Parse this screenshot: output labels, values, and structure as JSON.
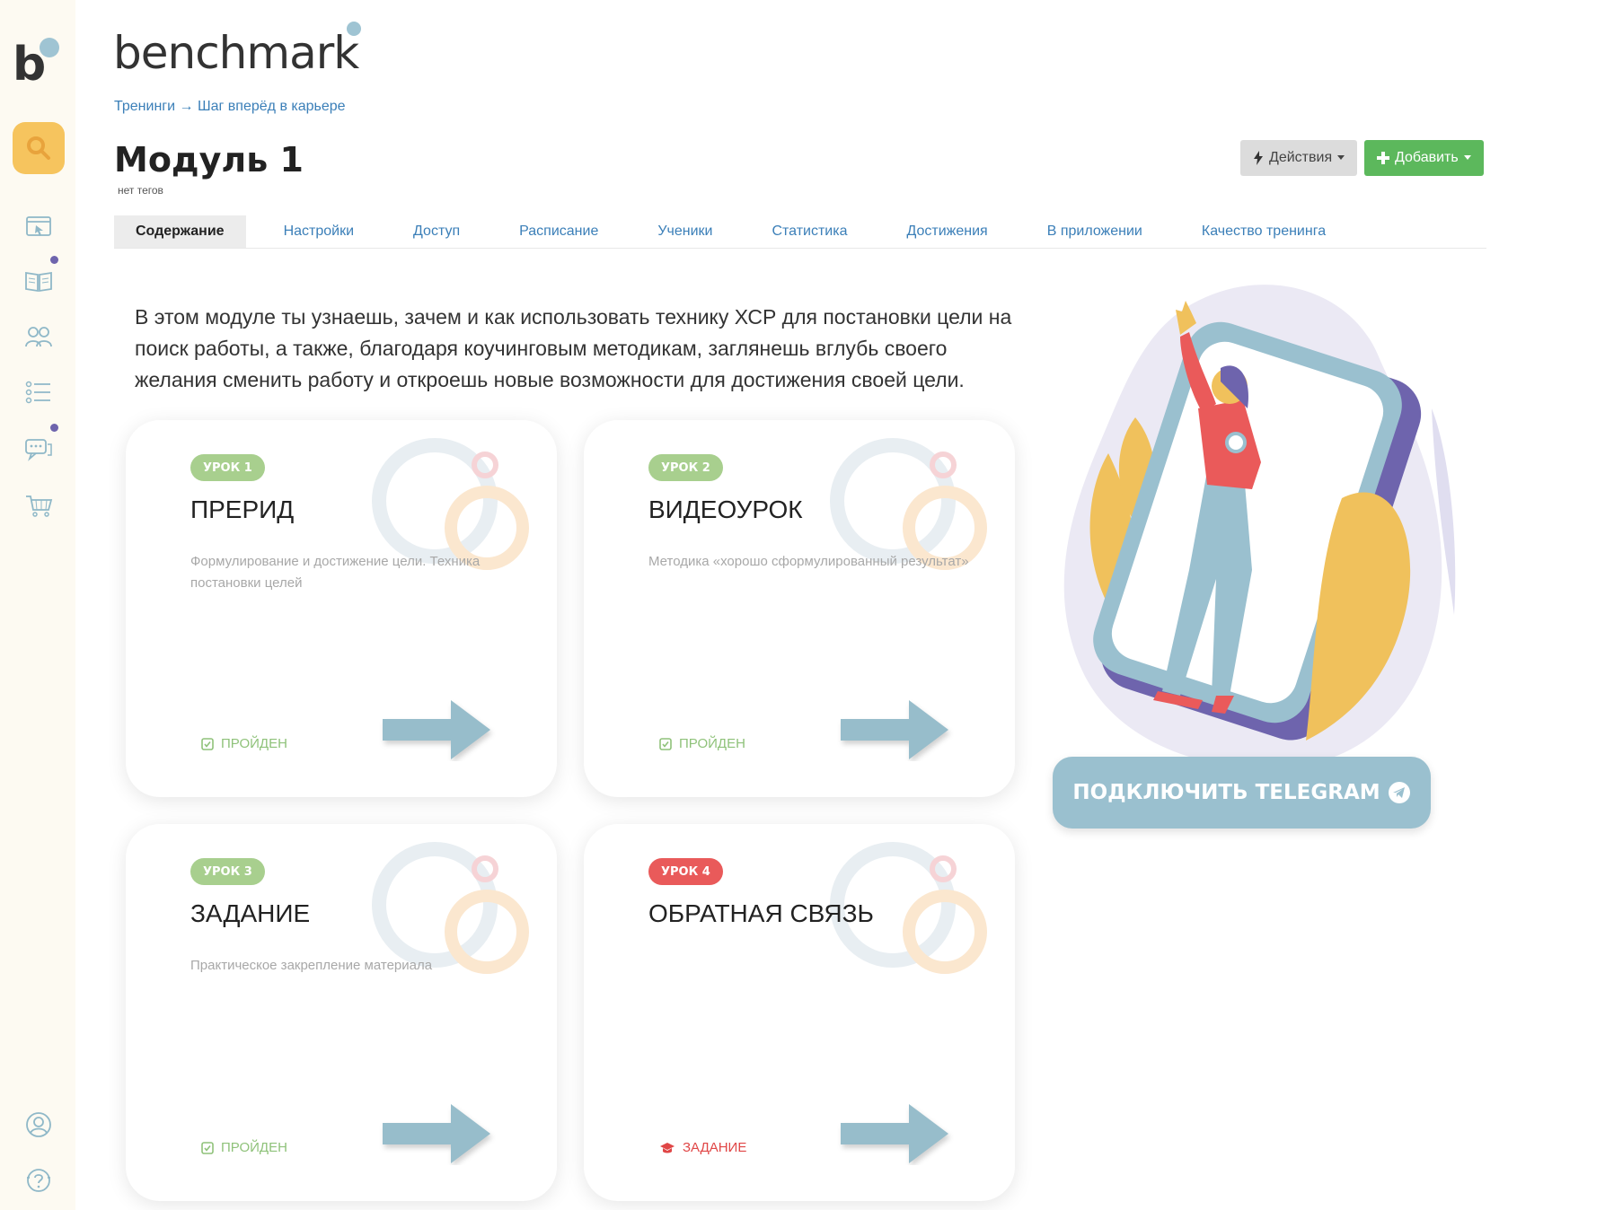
{
  "brand": {
    "name": "benchmark",
    "sidebar_letter": "b"
  },
  "breadcrumb": {
    "root": "Тренинги",
    "separator": " → ",
    "current": "Шаг вперёд в карьере"
  },
  "page": {
    "title": "Модуль 1",
    "tags_note": "нет тегов"
  },
  "toolbar": {
    "actions_label": "Действия",
    "add_label": "Добавить"
  },
  "tabs": [
    {
      "label": "Содержание",
      "active": true
    },
    {
      "label": "Настройки"
    },
    {
      "label": "Доступ"
    },
    {
      "label": "Расписание"
    },
    {
      "label": "Ученики"
    },
    {
      "label": "Статистика"
    },
    {
      "label": "Достижения"
    },
    {
      "label": "В приложении"
    },
    {
      "label": "Качество тренинга"
    }
  ],
  "intro": "В этом модуле ты узнаешь, зачем и как использовать технику ХСР для постановки цели на поиск работы, а также, благодаря коучинговым методикам, заглянешь вглубь своего желания сменить работу и откроешь новые возможности для достижения своей цели.",
  "lessons": [
    {
      "badge": "УРОК 1",
      "title": "ПРЕРИД",
      "desc": "Формулирование и достижение цели. Техника постановки целей",
      "status": "ПРОЙДЕН",
      "status_type": "done"
    },
    {
      "badge": "УРОК 2",
      "title": "ВИДЕОУРОК",
      "desc": "Методика «хорошо сформулированный результат»",
      "status": "ПРОЙДЕН",
      "status_type": "done"
    },
    {
      "badge": "УРОК 3",
      "title": "ЗАДАНИЕ",
      "desc": "Практическое закрепление материала",
      "status": "ПРОЙДЕН",
      "status_type": "done"
    },
    {
      "badge": "УРОК 4",
      "title": "ОБРАТНАЯ СВЯЗЬ",
      "desc": "",
      "status": "ЗАДАНИЕ",
      "status_type": "task"
    }
  ],
  "telegram": {
    "label": "ПОДКЛЮЧИТЬ TELEGRAM"
  },
  "colors": {
    "accent_blue": "#3b7fb8",
    "green": "#5cb85c",
    "badge_green": "#a8cf8e",
    "badge_red": "#e95a5a",
    "sidebar_bg": "#fdfaf2",
    "search_yellow": "#f6c45e",
    "telegram": "#9ac0cf"
  },
  "icons": [
    "search-icon",
    "cursor-window-icon",
    "book-icon",
    "people-icon",
    "list-icon",
    "chat-icon",
    "cart-icon",
    "user-icon",
    "help-icon"
  ]
}
